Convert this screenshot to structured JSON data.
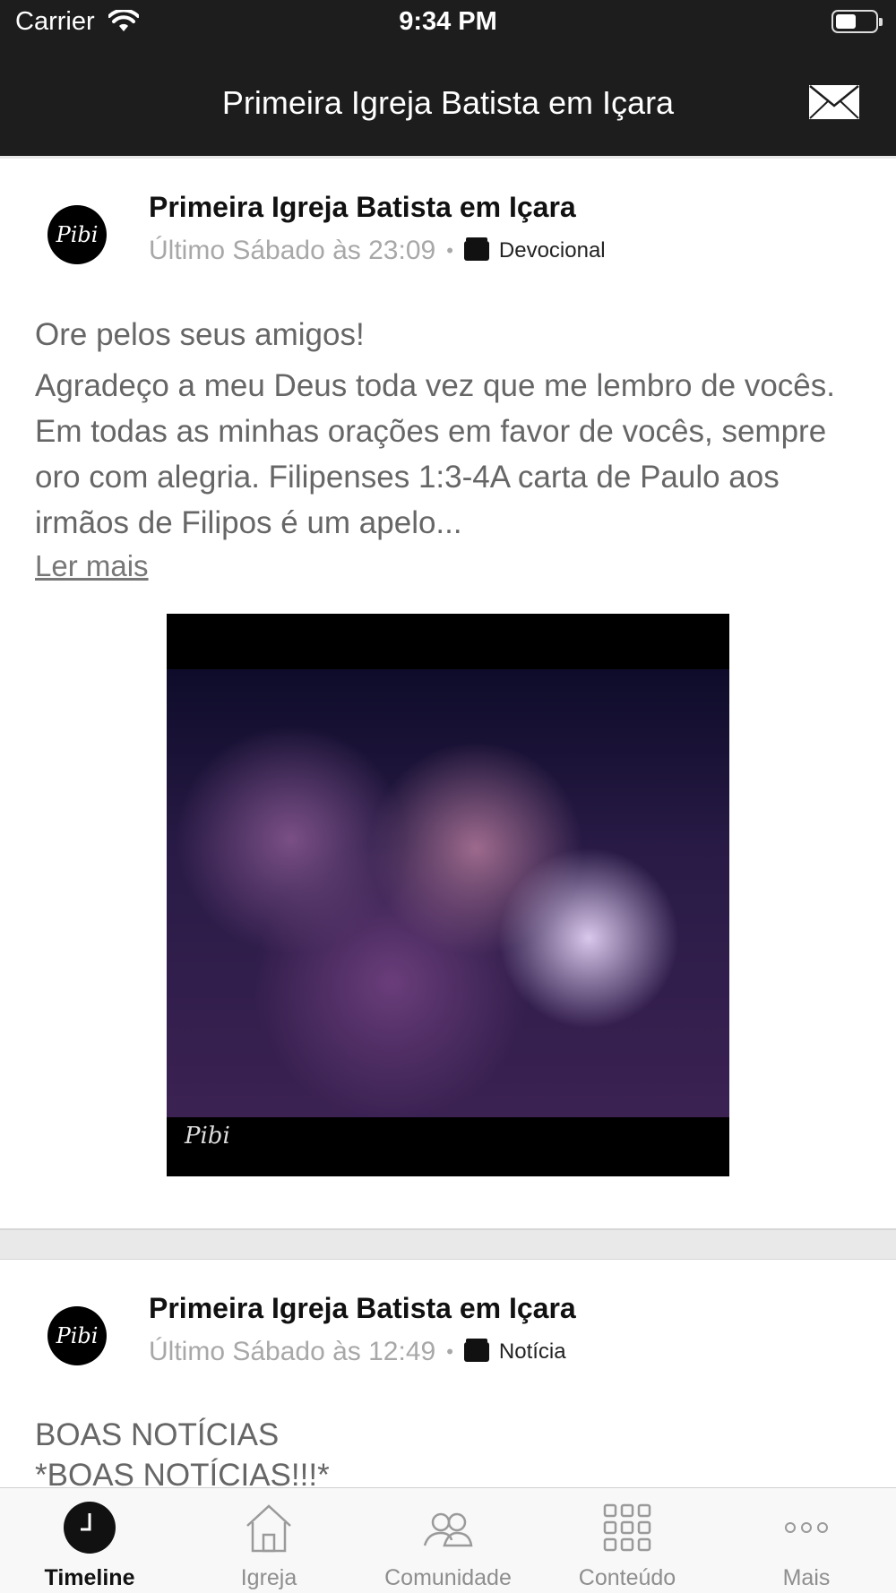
{
  "status_bar": {
    "carrier": "Carrier",
    "time": "9:34 PM"
  },
  "nav": {
    "title": "Primeira Igreja Batista em Içara",
    "mail_icon": "envelope-icon"
  },
  "posts": [
    {
      "avatar_text": "Pibi",
      "author": "Primeira Igreja Batista em Içara",
      "time": "Último Sábado às 23:09",
      "separator": "•",
      "category": "Devocional",
      "title": "Ore pelos seus amigos!",
      "body": "Agradeço a meu Deus toda vez que me lembro de vocês. Em todas as minhas orações em favor de vocês, sempre oro com alegria. Filipenses 1:3-4A carta de Paulo aos irmãos de Filipos é um apelo...",
      "read_more": "Ler mais",
      "image_watermark": "Pibi"
    },
    {
      "avatar_text": "Pibi",
      "author": "Primeira Igreja Batista em Içara",
      "time": "Último Sábado às 12:49",
      "separator": "•",
      "category": "Notícia",
      "title": "BOAS NOTÍCIAS",
      "body": "*BOAS NOTÍCIAS!!!*"
    }
  ],
  "tabs": [
    {
      "label": "Timeline",
      "icon": "clock-icon",
      "active": true
    },
    {
      "label": "Igreja",
      "icon": "house-icon",
      "active": false
    },
    {
      "label": "Comunidade",
      "icon": "people-icon",
      "active": false
    },
    {
      "label": "Conteúdo",
      "icon": "grid-icon",
      "active": false
    },
    {
      "label": "Mais",
      "icon": "more-dots-icon",
      "active": false
    }
  ]
}
